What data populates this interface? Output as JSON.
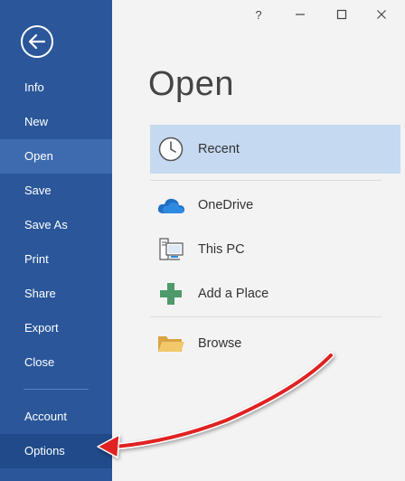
{
  "window": {
    "help_label": "?",
    "minimize_label": "—",
    "maximize_label": "☐",
    "close_label": "✕"
  },
  "sidebar": {
    "back_icon": "back-arrow-icon",
    "items": [
      {
        "label": "Info"
      },
      {
        "label": "New"
      },
      {
        "label": "Open",
        "selected": true
      },
      {
        "label": "Save"
      },
      {
        "label": "Save As"
      },
      {
        "label": "Print"
      },
      {
        "label": "Share"
      },
      {
        "label": "Export"
      },
      {
        "label": "Close"
      },
      {
        "label": "Account"
      },
      {
        "label": "Options",
        "highlighted": true
      }
    ]
  },
  "main": {
    "title": "Open",
    "locations": [
      {
        "label": "Recent",
        "icon": "clock-icon",
        "selected": true
      },
      {
        "label": "OneDrive",
        "icon": "cloud-icon"
      },
      {
        "label": "This PC",
        "icon": "computer-icon"
      },
      {
        "label": "Add a Place",
        "icon": "plus-icon"
      },
      {
        "label": "Browse",
        "icon": "folder-icon"
      }
    ]
  },
  "colors": {
    "sidebar_bg": "#2b579a",
    "sidebar_selected": "#3e6bb0",
    "recent_highlight": "#c5d9f1",
    "annotation_arrow": "#e02020"
  }
}
